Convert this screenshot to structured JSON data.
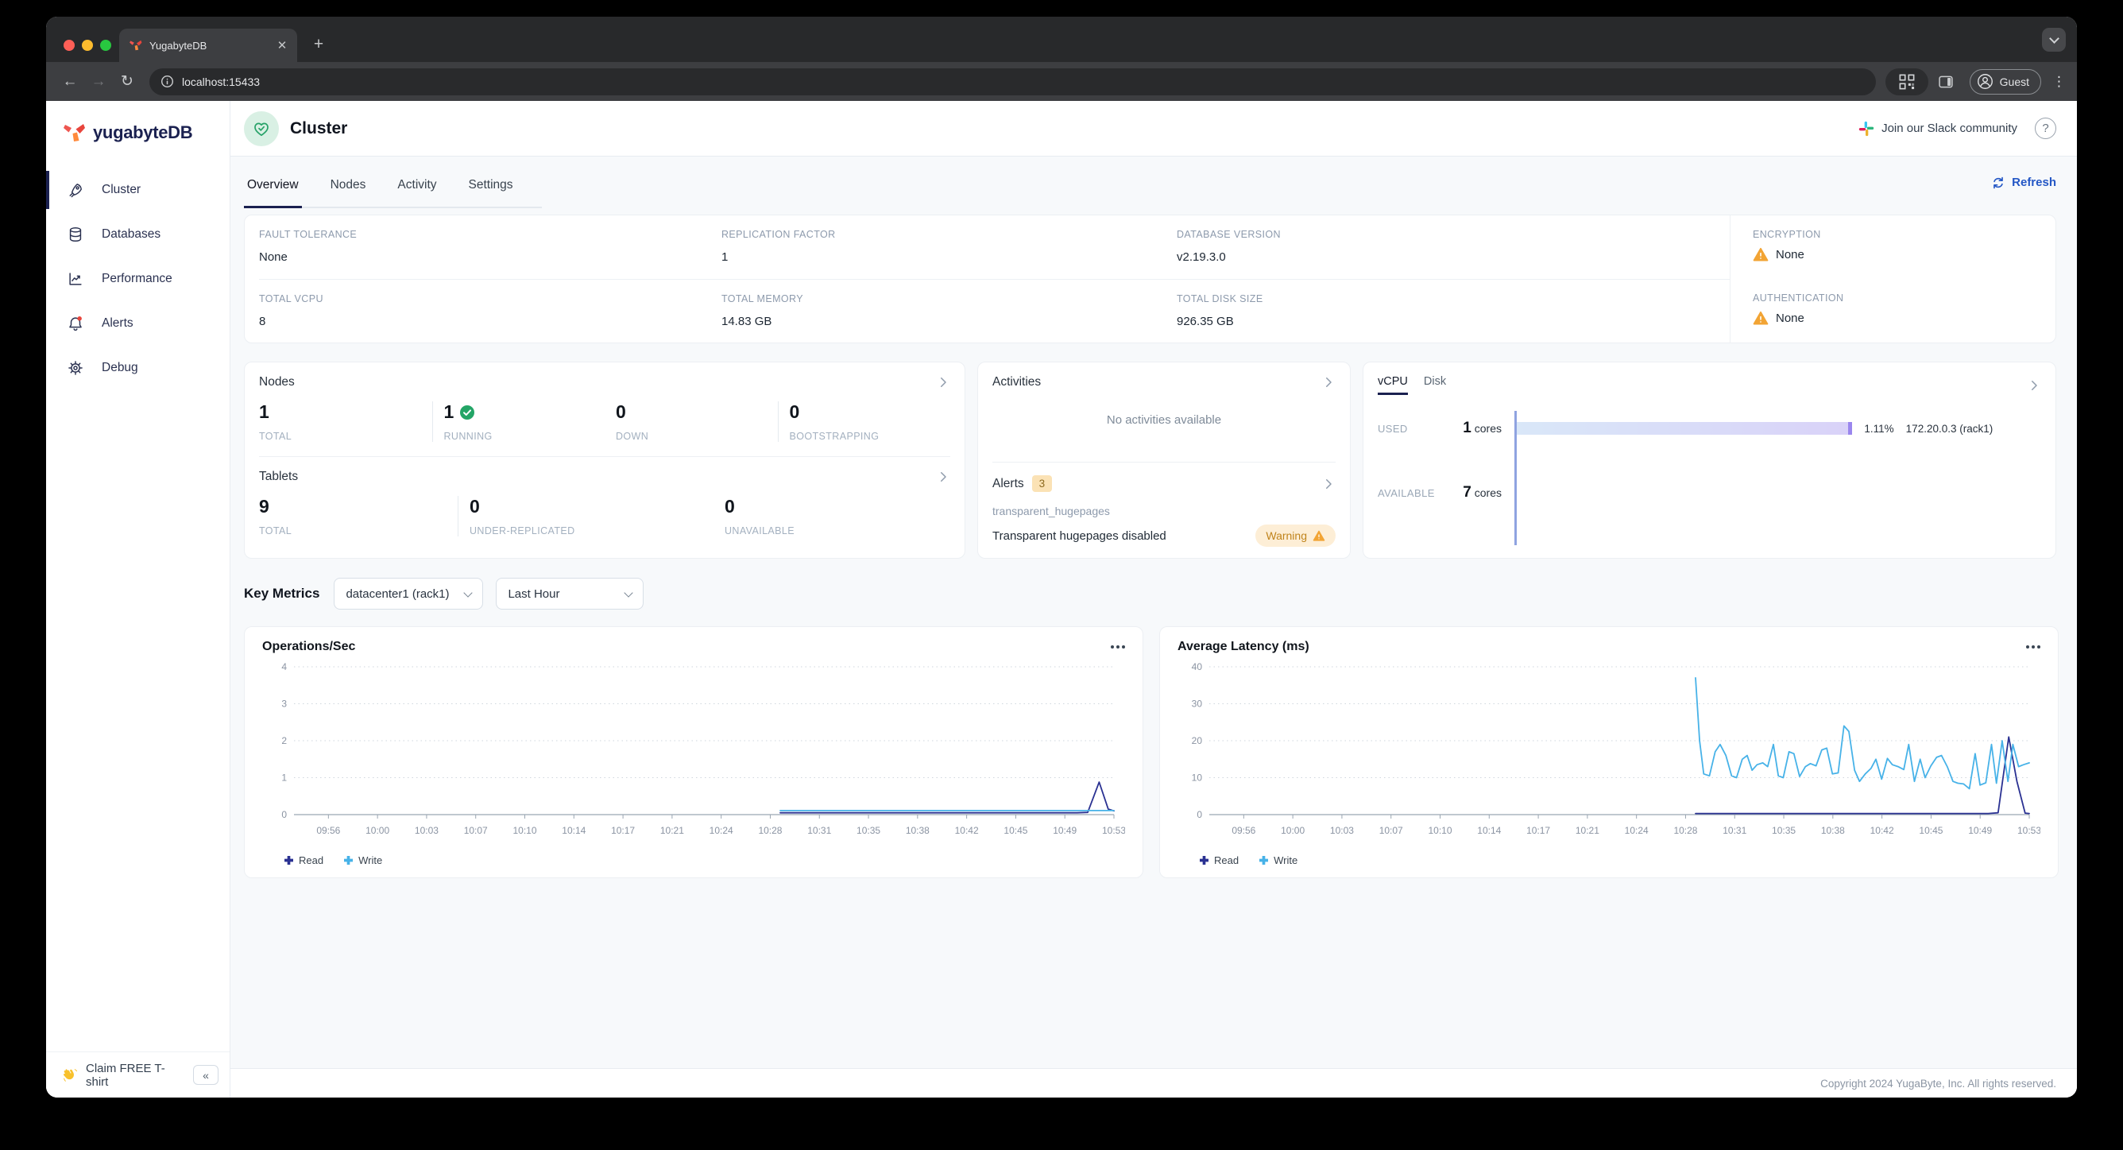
{
  "browser": {
    "tab_title": "YugabyteDB",
    "url": "localhost:15433",
    "profile_label": "Guest"
  },
  "sidebar": {
    "logo_text": "yugabyteDB",
    "items": [
      {
        "label": "Cluster",
        "icon": "rocket-icon",
        "active": true
      },
      {
        "label": "Databases",
        "icon": "database-icon",
        "active": false
      },
      {
        "label": "Performance",
        "icon": "performance-chart-icon",
        "active": false
      },
      {
        "label": "Alerts",
        "icon": "bell-icon",
        "active": false,
        "notification_dot": true
      },
      {
        "label": "Debug",
        "icon": "gear-icon",
        "active": false
      }
    ],
    "claim_label": "Claim FREE T-shirt",
    "collapse_glyph": "«"
  },
  "header": {
    "title": "Cluster",
    "slack_label": "Join our Slack community",
    "help_glyph": "?"
  },
  "tabs": {
    "items": [
      "Overview",
      "Nodes",
      "Activity",
      "Settings"
    ],
    "active": "Overview",
    "refresh_label": "Refresh"
  },
  "info": {
    "fields": [
      {
        "label": "FAULT TOLERANCE",
        "value": "None"
      },
      {
        "label": "REPLICATION FACTOR",
        "value": "1"
      },
      {
        "label": "DATABASE VERSION",
        "value": "v2.19.3.0"
      },
      {
        "label": "ENCRYPTION",
        "value": "None",
        "warning": true
      },
      {
        "label": "TOTAL VCPU",
        "value": "8"
      },
      {
        "label": "TOTAL MEMORY",
        "value": "14.83 GB"
      },
      {
        "label": "TOTAL DISK SIZE",
        "value": "926.35 GB"
      },
      {
        "label": "AUTHENTICATION",
        "value": "None",
        "warning": true
      }
    ]
  },
  "nodes_panel": {
    "title": "Nodes",
    "stats": [
      {
        "value": "1",
        "label": "TOTAL"
      },
      {
        "value": "1",
        "label": "RUNNING",
        "check": true
      },
      {
        "value": "0",
        "label": "DOWN"
      },
      {
        "value": "0",
        "label": "BOOTSTRAPPING"
      }
    ]
  },
  "tablets_panel": {
    "title": "Tablets",
    "stats": [
      {
        "value": "9",
        "label": "TOTAL"
      },
      {
        "value": "0",
        "label": "UNDER-REPLICATED"
      },
      {
        "value": "0",
        "label": "UNAVAILABLE"
      }
    ]
  },
  "activities_panel": {
    "title": "Activities",
    "empty_text": "No activities available"
  },
  "alerts_panel": {
    "title": "Alerts",
    "count": "3",
    "alert_name": "transparent_hugepages",
    "alert_desc": "Transparent hugepages disabled",
    "severity": "Warning"
  },
  "usage_panel": {
    "tabs": [
      "vCPU",
      "Disk"
    ],
    "active_tab": "vCPU",
    "used_label": "USED",
    "used_value": "1",
    "used_unit": "cores",
    "used_percent": "1.11%",
    "used_node": "172.20.0.3 (rack1)",
    "available_label": "AVAILABLE",
    "available_value": "7",
    "available_unit": "cores"
  },
  "key_metrics": {
    "title": "Key Metrics",
    "region_select": "datacenter1 (rack1)",
    "time_select": "Last Hour"
  },
  "footer": {
    "copyright": "Copyright 2024 YugaByte, Inc. All rights reserved."
  },
  "colors": {
    "brand_navy": "#1b2150",
    "link_blue": "#2457c5",
    "healthy_green": "#23a566",
    "warning_orange": "#f2a434",
    "read_series": "#2a3192",
    "write_series": "#47b2e8"
  },
  "chart_data": [
    {
      "type": "line",
      "title": "Operations/Sec",
      "ylim": [
        0,
        4
      ],
      "yticks": [
        0,
        1,
        2,
        3,
        4
      ],
      "grid": "dotted-horizontal",
      "legend_position": "bottom",
      "x_ticks": [
        "09:56",
        "10:00",
        "10:03",
        "10:07",
        "10:10",
        "10:14",
        "10:17",
        "10:21",
        "10:24",
        "10:28",
        "10:31",
        "10:35",
        "10:38",
        "10:42",
        "10:45",
        "10:49",
        "10:53"
      ],
      "series": [
        {
          "name": "Read",
          "color": "#2a3192",
          "points": [
            [
              0.593,
              0.05
            ],
            [
              0.7,
              0.05
            ],
            [
              0.8,
              0.05
            ],
            [
              0.9,
              0.05
            ],
            [
              0.955,
              0.05
            ],
            [
              0.968,
              0.06
            ],
            [
              0.982,
              0.88
            ],
            [
              0.993,
              0.15
            ],
            [
              1,
              0.1
            ]
          ]
        },
        {
          "name": "Write",
          "color": "#47b2e8",
          "points": [
            [
              0.593,
              0.11
            ],
            [
              0.7,
              0.11
            ],
            [
              0.8,
              0.11
            ],
            [
              0.9,
              0.11
            ],
            [
              1,
              0.11
            ]
          ]
        }
      ]
    },
    {
      "type": "line",
      "title": "Average Latency (ms)",
      "ylim": [
        0,
        40
      ],
      "yticks": [
        0,
        10,
        20,
        30,
        40
      ],
      "grid": "dotted-horizontal",
      "legend_position": "bottom",
      "x_ticks": [
        "09:56",
        "10:00",
        "10:03",
        "10:07",
        "10:10",
        "10:14",
        "10:17",
        "10:21",
        "10:24",
        "10:28",
        "10:31",
        "10:35",
        "10:38",
        "10:42",
        "10:45",
        "10:49",
        "10:53"
      ],
      "series": [
        {
          "name": "Read",
          "color": "#2a3192",
          "points": [
            [
              0.593,
              0.3
            ],
            [
              0.7,
              0.3
            ],
            [
              0.8,
              0.3
            ],
            [
              0.9,
              0.3
            ],
            [
              0.95,
              0.3
            ],
            [
              0.962,
              0.5
            ],
            [
              0.975,
              21
            ],
            [
              0.985,
              9
            ],
            [
              0.995,
              0.4
            ],
            [
              1,
              0.3
            ]
          ]
        },
        {
          "name": "Write",
          "color": "#47b2e8",
          "points": [
            [
              0.593,
              37
            ],
            [
              0.598,
              20
            ],
            [
              0.603,
              11
            ],
            [
              0.61,
              10.5
            ],
            [
              0.617,
              17
            ],
            [
              0.623,
              19
            ],
            [
              0.63,
              16
            ],
            [
              0.637,
              10.5
            ],
            [
              0.643,
              10
            ],
            [
              0.65,
              15
            ],
            [
              0.656,
              16
            ],
            [
              0.662,
              12
            ],
            [
              0.668,
              13.5
            ],
            [
              0.675,
              14
            ],
            [
              0.681,
              13
            ],
            [
              0.688,
              19
            ],
            [
              0.694,
              10.5
            ],
            [
              0.7,
              10
            ],
            [
              0.707,
              17
            ],
            [
              0.713,
              16.5
            ],
            [
              0.72,
              10.3
            ],
            [
              0.727,
              13
            ],
            [
              0.733,
              13.8
            ],
            [
              0.74,
              13.2
            ],
            [
              0.747,
              17.5
            ],
            [
              0.753,
              18
            ],
            [
              0.76,
              11
            ],
            [
              0.767,
              11.3
            ],
            [
              0.774,
              24
            ],
            [
              0.78,
              22.5
            ],
            [
              0.787,
              12
            ],
            [
              0.793,
              9
            ],
            [
              0.8,
              11
            ],
            [
              0.807,
              12.5
            ],
            [
              0.813,
              15
            ],
            [
              0.82,
              9.6
            ],
            [
              0.827,
              15.2
            ],
            [
              0.833,
              13.5
            ],
            [
              0.84,
              13
            ],
            [
              0.847,
              12.2
            ],
            [
              0.853,
              19
            ],
            [
              0.86,
              9
            ],
            [
              0.867,
              15
            ],
            [
              0.873,
              10
            ],
            [
              0.88,
              13.2
            ],
            [
              0.887,
              15.5
            ],
            [
              0.893,
              16
            ],
            [
              0.9,
              13
            ],
            [
              0.907,
              9
            ],
            [
              0.913,
              8.5
            ],
            [
              0.92,
              8.3
            ],
            [
              0.927,
              7
            ],
            [
              0.934,
              16.5
            ],
            [
              0.94,
              8
            ],
            [
              0.947,
              8.6
            ],
            [
              0.954,
              19
            ],
            [
              0.96,
              8.5
            ],
            [
              0.967,
              20
            ],
            [
              0.974,
              9
            ],
            [
              0.98,
              19
            ],
            [
              0.987,
              13
            ],
            [
              0.993,
              13.5
            ],
            [
              1,
              14
            ]
          ]
        }
      ]
    }
  ]
}
